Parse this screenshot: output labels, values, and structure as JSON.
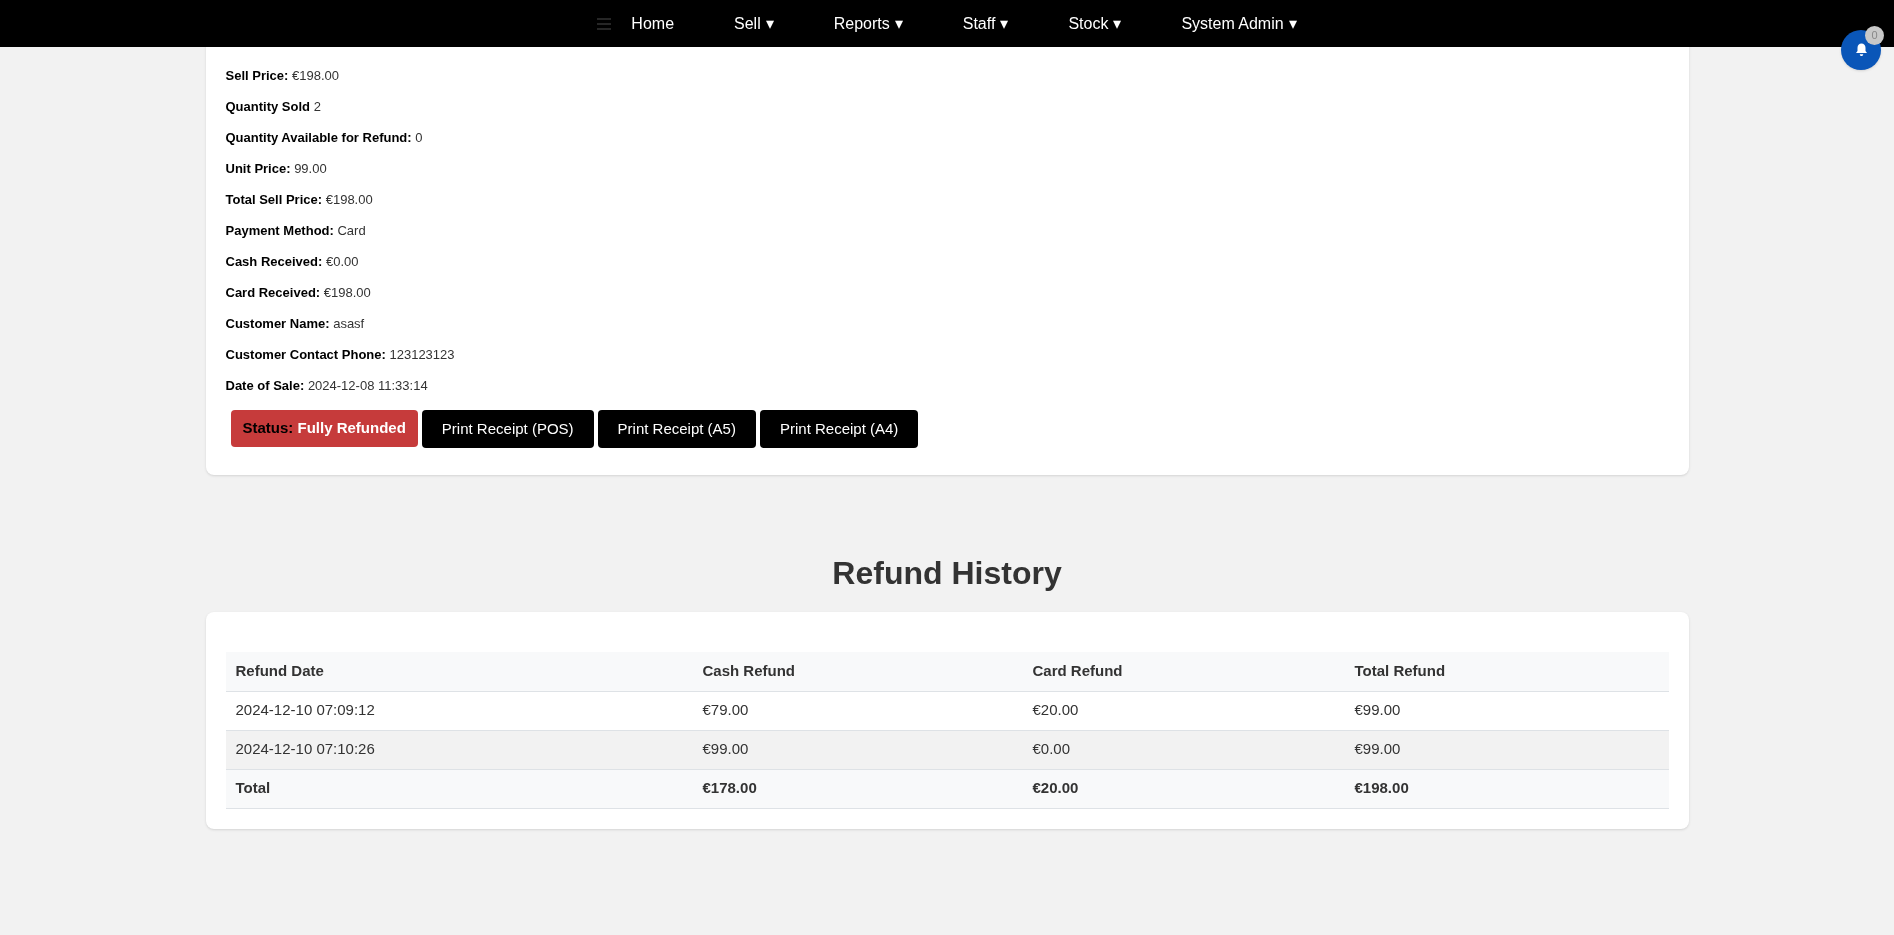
{
  "nav": {
    "items": [
      {
        "label": "Home",
        "dropdown": false
      },
      {
        "label": "Sell",
        "dropdown": true
      },
      {
        "label": "Reports",
        "dropdown": true
      },
      {
        "label": "Staff",
        "dropdown": true
      },
      {
        "label": "Stock",
        "dropdown": true
      },
      {
        "label": "System Admin",
        "dropdown": true
      }
    ],
    "caret": "▾"
  },
  "notifications": {
    "count": "0"
  },
  "details": [
    {
      "label": "Sell Price:",
      "value": "€198.00"
    },
    {
      "label": "Quantity Sold",
      "value": "2"
    },
    {
      "label": "Quantity Available for Refund:",
      "value": "0"
    },
    {
      "label": "Unit Price:",
      "value": "99.00"
    },
    {
      "label": "Total Sell Price:",
      "value": "€198.00"
    },
    {
      "label": "Payment Method:",
      "value": "Card"
    },
    {
      "label": "Cash Received:",
      "value": "€0.00"
    },
    {
      "label": "Card Received:",
      "value": "€198.00"
    },
    {
      "label": "Customer Name:",
      "value": "asasf"
    },
    {
      "label": "Customer Contact Phone:",
      "value": "123123123"
    },
    {
      "label": "Date of Sale:",
      "value": "2024-12-08 11:33:14"
    }
  ],
  "status": {
    "label": "Status:",
    "value": "Fully Refunded",
    "color": "#c63b3b"
  },
  "buttons": [
    "Print Receipt (POS)",
    "Print Receipt (A5)",
    "Print Receipt (A4)"
  ],
  "refund_history": {
    "title": "Refund History",
    "columns": [
      "Refund Date",
      "Cash Refund",
      "Card Refund",
      "Total Refund"
    ],
    "rows": [
      [
        "2024-12-10 07:09:12",
        "€79.00",
        "€20.00",
        "€99.00"
      ],
      [
        "2024-12-10 07:10:26",
        "€99.00",
        "€0.00",
        "€99.00"
      ]
    ],
    "total": [
      "Total",
      "€178.00",
      "€20.00",
      "€198.00"
    ]
  }
}
